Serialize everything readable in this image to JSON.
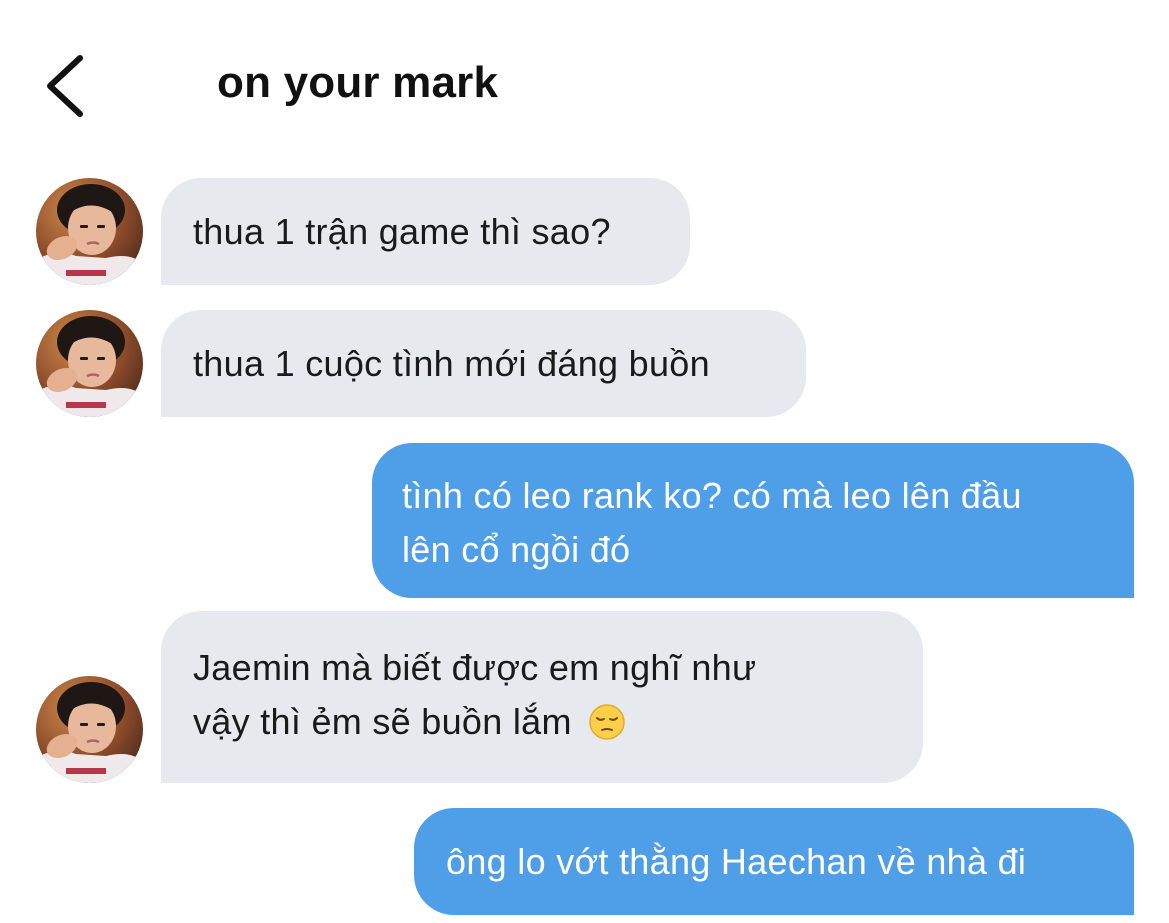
{
  "header": {
    "title": "on your mark",
    "back_icon": "chevron-left-icon"
  },
  "colors": {
    "incoming_bubble": "#e6e9ed",
    "outgoing_bubble": "#4f9ee8",
    "outgoing_text": "#ffffff"
  },
  "messages": [
    {
      "sender": "other",
      "text": "thua 1 trận game thì sao?"
    },
    {
      "sender": "other",
      "text": "thua 1 cuộc tình mới đáng buồn"
    },
    {
      "sender": "me",
      "lines": [
        "tình có leo rank ko? có mà leo lên đầu",
        "lên cổ ngồi đó"
      ]
    },
    {
      "sender": "other",
      "lines": [
        "Jaemin mà biết được em nghĩ như",
        "vậy thì ẻm sẽ buồn lắm"
      ],
      "emoji": "pensive-face-emoji"
    },
    {
      "sender": "me",
      "text": "ông lo vớt thằng Haechan về nhà đi"
    }
  ]
}
